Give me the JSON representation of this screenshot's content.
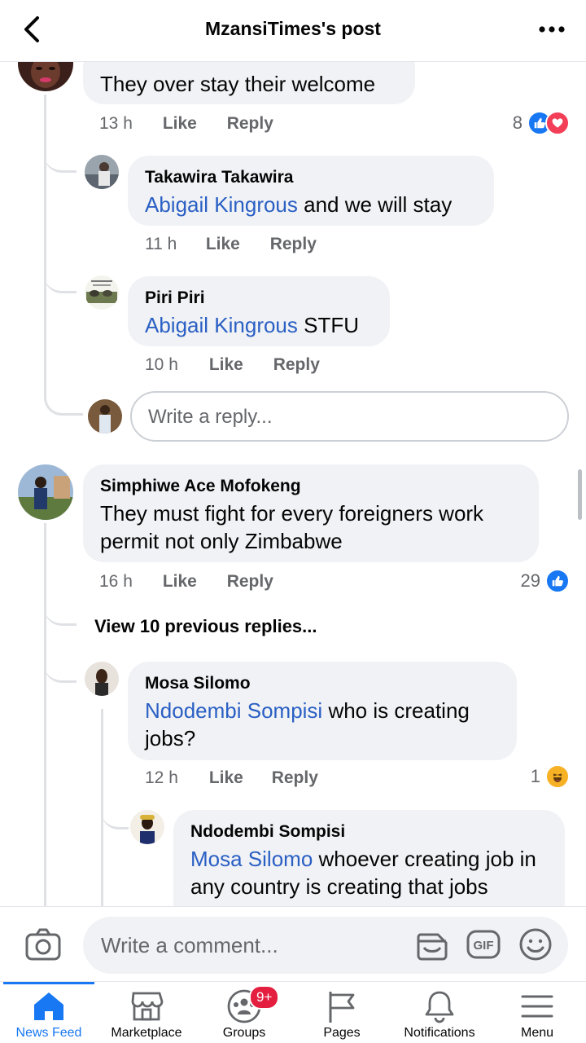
{
  "header": {
    "title": "MzansiTimes's post"
  },
  "comments": {
    "c1": {
      "text": "They over stay their welcome",
      "time": "13 h",
      "like": "Like",
      "reply": "Reply",
      "react_count": "8",
      "replies": {
        "r1": {
          "name": "Takawira Takawira",
          "tag": "Abigail Kingrous",
          "text": " and we will stay",
          "time": "11 h",
          "like": "Like",
          "reply": "Reply"
        },
        "r2": {
          "name": "Piri Piri",
          "tag": "Abigail Kingrous",
          "text": " STFU",
          "time": "10 h",
          "like": "Like",
          "reply": "Reply"
        }
      },
      "reply_placeholder": "Write a reply..."
    },
    "c2": {
      "name": "Simphiwe Ace Mofokeng",
      "text": "They must fight for every foreigners work permit not only Zimbabwe",
      "time": "16 h",
      "like": "Like",
      "reply": "Reply",
      "react_count": "29",
      "view_previous": "View 10 previous replies...",
      "replies": {
        "r1": {
          "name": "Mosa Silomo",
          "tag": "Ndodembi Sompisi",
          "text": " who is creating jobs?",
          "time": "12 h",
          "like": "Like",
          "reply": "Reply",
          "react_count": "1"
        },
        "r2": {
          "name": "Ndodembi Sompisi",
          "tag": "Mosa Silomo",
          "text": " whoever creating job in any country is creating that jobs"
        }
      }
    }
  },
  "composer": {
    "placeholder": "Write a comment..."
  },
  "nav": {
    "items": [
      {
        "label": "News Feed"
      },
      {
        "label": "Marketplace"
      },
      {
        "label": "Groups",
        "badge": "9+"
      },
      {
        "label": "Pages"
      },
      {
        "label": "Notifications"
      },
      {
        "label": "Menu"
      }
    ]
  },
  "colors": {
    "accent": "#1877f2",
    "mention": "#2a5fc4",
    "badge": "#e41e3f",
    "bubble": "#f0f2f5"
  }
}
